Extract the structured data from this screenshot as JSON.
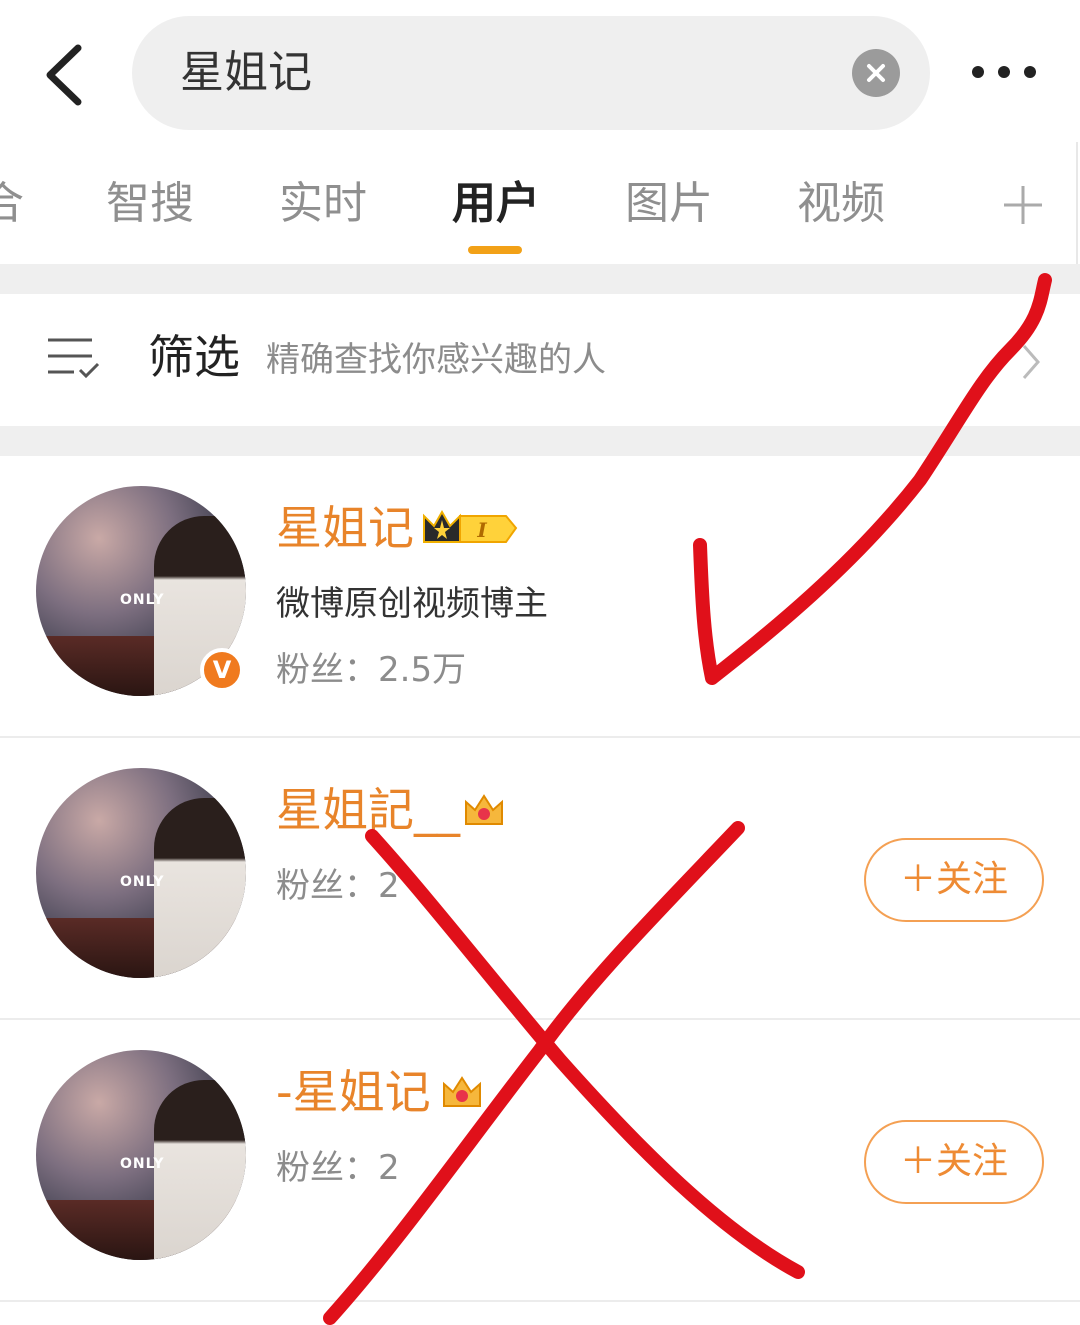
{
  "search": {
    "query": "星姐记"
  },
  "tabs": [
    {
      "label": "合"
    },
    {
      "label": "智搜"
    },
    {
      "label": "实时"
    },
    {
      "label": "用户"
    },
    {
      "label": "图片"
    },
    {
      "label": "视频"
    }
  ],
  "active_tab": "用户",
  "filter": {
    "title": "筛选",
    "description": "精确查找你感兴趣的人"
  },
  "users": [
    {
      "name": "星姐记",
      "description": "微博原创视频博主",
      "fans": "粉丝：2.5万",
      "verified": true,
      "level_badge": "I"
    },
    {
      "name": "星姐記__",
      "fans": "粉丝：2",
      "follow_label": "＋关注"
    },
    {
      "name": "-星姐记",
      "fans": "粉丝：2",
      "follow_label": "＋关注"
    }
  ],
  "avatar_sign": "ONLY",
  "verified_badge": "V",
  "colors": {
    "accent": "#f2a117",
    "username": "#e8842a",
    "annotation": "#e0101a"
  }
}
